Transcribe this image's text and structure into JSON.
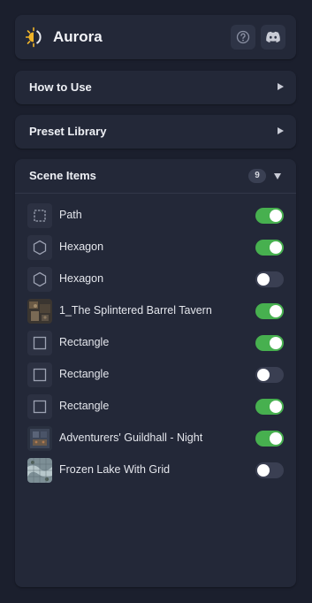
{
  "app": {
    "title": "Aurora",
    "logo_icon": "sun-moon-logo-icon",
    "help_icon": "help-circle-icon",
    "discord_icon": "discord-icon"
  },
  "sections": [
    {
      "title": "How to Use",
      "state": "collapsed"
    },
    {
      "title": "Preset Library",
      "state": "collapsed"
    }
  ],
  "scene": {
    "title": "Scene Items",
    "count": "9",
    "state": "expanded",
    "items": [
      {
        "name": "Path",
        "icon": "path-icon",
        "enabled": true
      },
      {
        "name": "Hexagon",
        "icon": "hexagon-icon",
        "enabled": true
      },
      {
        "name": "Hexagon",
        "icon": "hexagon-icon",
        "enabled": false
      },
      {
        "name": "1_The Splintered Barrel Tavern",
        "icon": "map-thumbnail-tavern",
        "enabled": true
      },
      {
        "name": "Rectangle",
        "icon": "rectangle-icon",
        "enabled": true
      },
      {
        "name": "Rectangle",
        "icon": "rectangle-icon",
        "enabled": false
      },
      {
        "name": "Rectangle",
        "icon": "rectangle-icon",
        "enabled": true
      },
      {
        "name": "Adventurers' Guildhall - Night",
        "icon": "map-thumbnail-guildhall",
        "enabled": true
      },
      {
        "name": "Frozen Lake With Grid",
        "icon": "map-thumbnail-frozen-lake",
        "enabled": false
      }
    ]
  },
  "colors": {
    "background": "#1b1f2d",
    "panel": "#232838",
    "toggle_on": "#47b04f",
    "toggle_off": "#3a3f52",
    "accent_logo": "#f0b429"
  }
}
